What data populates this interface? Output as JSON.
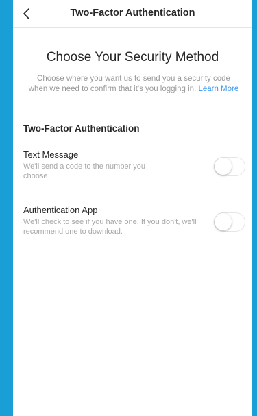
{
  "header": {
    "title": "Two-Factor Authentication",
    "back_icon": "chevron-left-icon"
  },
  "intro": {
    "heading": "Choose Your Security Method",
    "description": "Choose where you want us to send you a security code when we need to confirm that it's you logging in.",
    "learn_more": "Learn More"
  },
  "section": {
    "title": "Two-Factor Authentication"
  },
  "options": [
    {
      "title": "Text Message",
      "description": "We'll send a code to the number you choose.",
      "enabled": false
    },
    {
      "title": "Authentication App",
      "description": "We'll check to see if you have one. If you don't, we'll recommend one to download.",
      "enabled": false
    }
  ],
  "colors": {
    "frame_background": "#1a9ed6",
    "link": "#3897f0",
    "text_primary": "#262626",
    "text_secondary": "#999999"
  }
}
